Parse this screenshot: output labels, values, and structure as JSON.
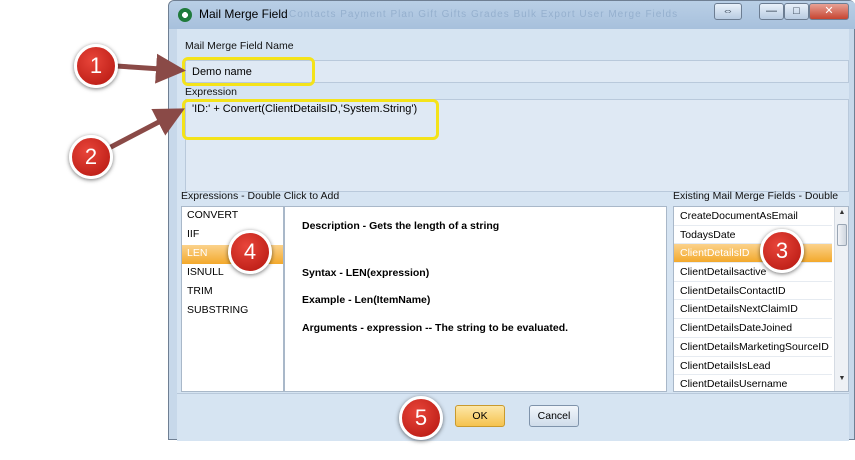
{
  "window": {
    "title": "Mail Merge Field",
    "background_menu": "Contacts    Payment Plan    Gift    Gifts Grades    Bulk Export    User Merge Fields",
    "restore_glyph": "⇔",
    "minimize_glyph": "—",
    "maximize_glyph": "□",
    "close_glyph": "✕"
  },
  "form": {
    "name_label": "Mail Merge Field Name",
    "name_value": "Demo name",
    "expression_label": "Expression",
    "expression_value": "'ID:' + Convert(ClientDetailsID,'System.String')"
  },
  "functions": {
    "label": "Expressions - Double Click to Add",
    "items": [
      "CONVERT",
      "IIF",
      "LEN",
      "ISNULL",
      "TRIM",
      "SUBSTRING"
    ],
    "selected_index": 2
  },
  "description": {
    "description": "Description - Gets the length of a string",
    "syntax": "Syntax - LEN(expression)",
    "example": "Example - Len(ItemName)",
    "arguments": "Arguments - expression -- The string to be evaluated."
  },
  "fields": {
    "label": "Existing Mail Merge Fields - Double",
    "items": [
      "CreateDocumentAsEmail",
      "TodaysDate",
      "ClientDetailsID",
      "ClientDetailsactive",
      "ClientDetailsContactID",
      "ClientDetailsNextClaimID",
      "ClientDetailsDateJoined",
      "ClientDetailsMarketingSourceID",
      "ClientDetailsIsLead",
      "ClientDetailsUsername"
    ],
    "selected_index": 2
  },
  "buttons": {
    "ok": "OK",
    "cancel": "Cancel"
  },
  "annotations": {
    "badge_1": "1",
    "badge_2": "2",
    "badge_3": "3",
    "badge_4": "4",
    "badge_5": "5"
  },
  "colors": {
    "highlight": "#f4e31a",
    "badge": "#d62b20",
    "selection": "#f3a92c",
    "arrow": "#8a4a47"
  }
}
